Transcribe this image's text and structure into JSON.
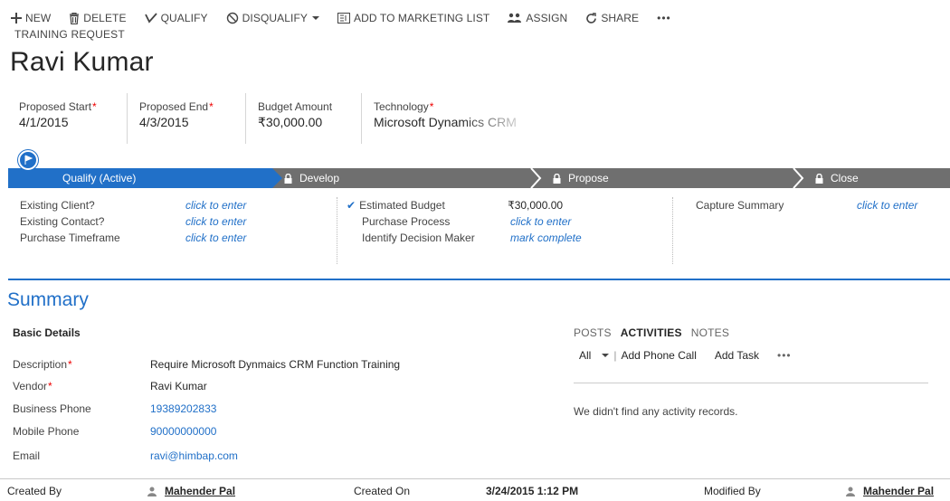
{
  "commands": {
    "new": "NEW",
    "delete": "DELETE",
    "qualify": "QUALIFY",
    "disqualify": "DISQUALIFY",
    "add_to_marketing_list": "ADD TO MARKETING LIST",
    "assign": "ASSIGN",
    "share": "SHARE",
    "more": "•••"
  },
  "entity_type": "TRAINING REQUEST",
  "record_name": "Ravi Kumar",
  "header_fields": [
    {
      "label": "Proposed Start",
      "value": "4/1/2015",
      "required": "*"
    },
    {
      "label": "Proposed End",
      "value": "4/3/2015",
      "required": "*"
    },
    {
      "label": "Budget Amount",
      "value": "₹30,000.00",
      "required": ""
    },
    {
      "label": "Technology",
      "value": "Microsoft Dynamics CRM",
      "required": "*"
    }
  ],
  "process": {
    "stages": [
      "Qualify (Active)",
      "Develop",
      "Propose",
      "Close"
    ],
    "column1": [
      {
        "label": "Existing Client?",
        "value": "click to enter"
      },
      {
        "label": "Existing Contact?",
        "value": "click to enter"
      },
      {
        "label": "Purchase Timeframe",
        "value": "click to enter"
      }
    ],
    "column2": [
      {
        "label": "Estimated Budget",
        "value": "₹30,000.00"
      },
      {
        "label": "Purchase Process",
        "value": "click to enter"
      },
      {
        "label": "Identify Decision Maker",
        "value": "mark complete"
      }
    ],
    "column3": [
      {
        "label": "Capture Summary",
        "value": "click to enter"
      }
    ]
  },
  "summary": {
    "title": "Summary",
    "section": "Basic Details",
    "fields": [
      {
        "label": "Description",
        "value": "Require Microsoft Dynmaics CRM Function Training",
        "required": "*"
      },
      {
        "label": "Vendor",
        "value": "Ravi Kumar",
        "required": "*"
      },
      {
        "label": "Business Phone",
        "value": "19389202833",
        "required": ""
      },
      {
        "label": "Mobile Phone",
        "value": "90000000000",
        "required": ""
      },
      {
        "label": "Email",
        "value": "ravi@himbap.com",
        "required": ""
      }
    ]
  },
  "social": {
    "tabs": [
      "POSTS",
      "ACTIVITIES",
      "NOTES"
    ],
    "active_tab": "ACTIVITIES",
    "filter": "All",
    "add_phone_call": "Add Phone Call",
    "add_task": "Add Task",
    "more": "•••",
    "empty_message": "We didn't find any activity records."
  },
  "footer": {
    "created_by_label": "Created By",
    "created_by": "Mahender Pal",
    "created_on_label": "Created On",
    "created_on": "3/24/2015 1:12 PM",
    "modified_by_label": "Modified By",
    "modified_by": "Mahender Pal"
  },
  "colors": {
    "accent": "#2170c8",
    "required": "#ee0000",
    "stage_inactive": "#6f6f6f"
  }
}
